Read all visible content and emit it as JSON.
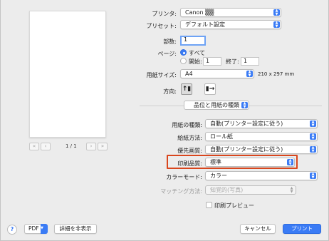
{
  "preview": {
    "page_indicator": "1 / 1",
    "nav_first": "«",
    "nav_prev": "‹",
    "nav_next": "›",
    "nav_last": "»"
  },
  "printer": {
    "label": "プリンタ:",
    "value": "Canon ▒▒"
  },
  "preset": {
    "label": "プリセット:",
    "value": "デフォルト設定"
  },
  "copies": {
    "label": "部数:",
    "value": "1"
  },
  "pages": {
    "label": "ページ:",
    "all_label": "すべて",
    "from_label": "開始:",
    "from_value": "1",
    "to_label": "終了:",
    "to_value": "1",
    "selected": "all"
  },
  "paper_size": {
    "label": "用紙サイズ:",
    "value": "A4",
    "dimensions": "210 x 297 mm"
  },
  "orientation": {
    "label": "方向:",
    "selected": "portrait"
  },
  "section_selector": {
    "value": "品位と用紙の種類"
  },
  "settings": {
    "media_type": {
      "label": "用紙の種類:",
      "value": "自動(プリンター設定に従う)"
    },
    "paper_source": {
      "label": "給紙方法:",
      "value": "ロール紙"
    },
    "priority_quality": {
      "label": "優先画質:",
      "value": "自動(プリンター設定に従う)"
    },
    "print_quality": {
      "label": "印刷品質:",
      "value": "標準"
    },
    "color_mode": {
      "label": "カラーモード:",
      "value": "カラー"
    },
    "matching": {
      "label": "マッチング方法:",
      "value": "知覚的(写真)"
    },
    "print_preview": {
      "label": "印刷プレビュー",
      "checked": false
    }
  },
  "footer": {
    "help": "?",
    "pdf_label": "PDF",
    "hide_details": "詳細を非表示",
    "cancel": "キャンセル",
    "print": "プリント"
  },
  "colors": {
    "accent": "#3a7bf5",
    "highlight_border": "#d9461d",
    "background": "#ececec"
  }
}
